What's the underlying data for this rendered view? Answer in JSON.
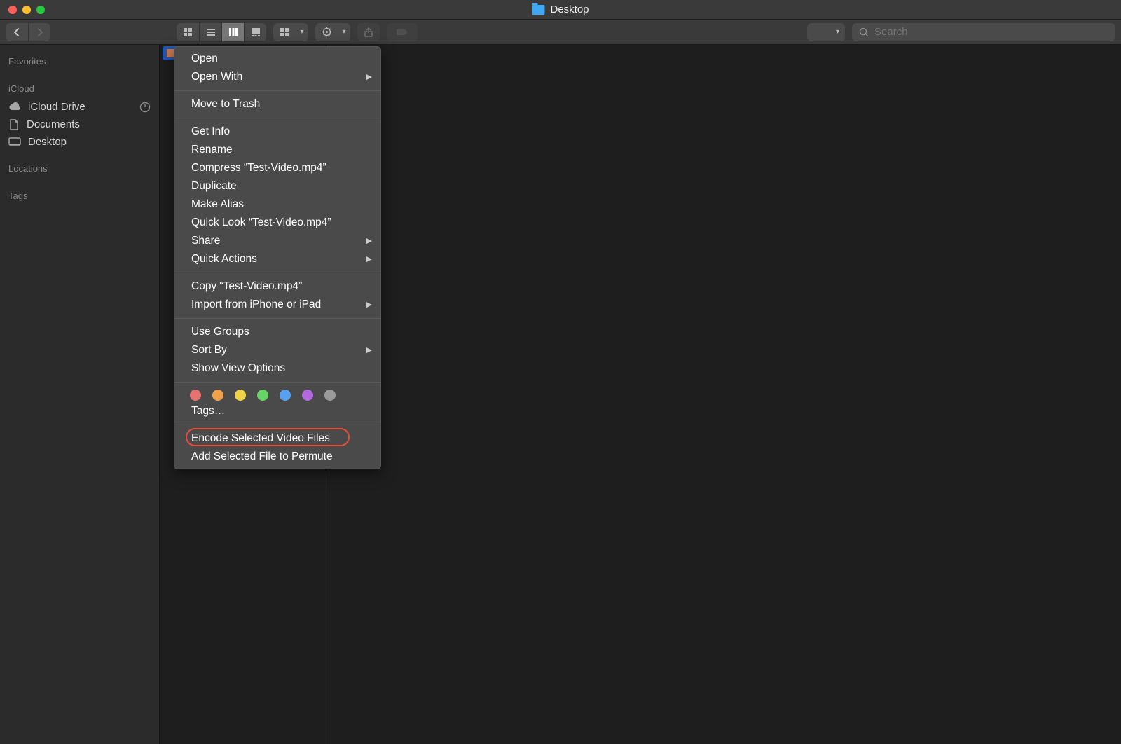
{
  "window": {
    "title": "Desktop"
  },
  "search": {
    "placeholder": "Search"
  },
  "sidebar": {
    "sections": {
      "favorites": {
        "header": "Favorites"
      },
      "icloud": {
        "header": "iCloud",
        "items": [
          {
            "label": "iCloud Drive"
          },
          {
            "label": "Documents"
          },
          {
            "label": "Desktop"
          }
        ]
      },
      "locations": {
        "header": "Locations"
      },
      "tags": {
        "header": "Tags"
      }
    }
  },
  "selected_file": {
    "name": "Test-Video.mp4"
  },
  "context_menu": {
    "group1": [
      {
        "label": "Open",
        "submenu": false
      },
      {
        "label": "Open With",
        "submenu": true
      }
    ],
    "group2": [
      {
        "label": "Move to Trash",
        "submenu": false
      }
    ],
    "group3": [
      {
        "label": "Get Info",
        "submenu": false
      },
      {
        "label": "Rename",
        "submenu": false
      },
      {
        "label": "Compress “Test-Video.mp4”",
        "submenu": false
      },
      {
        "label": "Duplicate",
        "submenu": false
      },
      {
        "label": "Make Alias",
        "submenu": false
      },
      {
        "label": "Quick Look “Test-Video.mp4”",
        "submenu": false
      },
      {
        "label": "Share",
        "submenu": true
      },
      {
        "label": "Quick Actions",
        "submenu": true
      }
    ],
    "group4": [
      {
        "label": "Copy “Test-Video.mp4”",
        "submenu": false
      },
      {
        "label": "Import from iPhone or iPad",
        "submenu": true
      }
    ],
    "group5": [
      {
        "label": "Use Groups",
        "submenu": false
      },
      {
        "label": "Sort By",
        "submenu": true
      },
      {
        "label": "Show View Options",
        "submenu": false
      }
    ],
    "tags_label": "Tags…",
    "tag_colors": [
      "#e57373",
      "#f0a24a",
      "#f0d24a",
      "#67d467",
      "#5aa0f0",
      "#b36ae0",
      "#9a9a9a"
    ],
    "group6": [
      {
        "label": "Encode Selected Video Files",
        "highlighted": true
      },
      {
        "label": "Add Selected File to Permute",
        "highlighted": false
      }
    ]
  }
}
